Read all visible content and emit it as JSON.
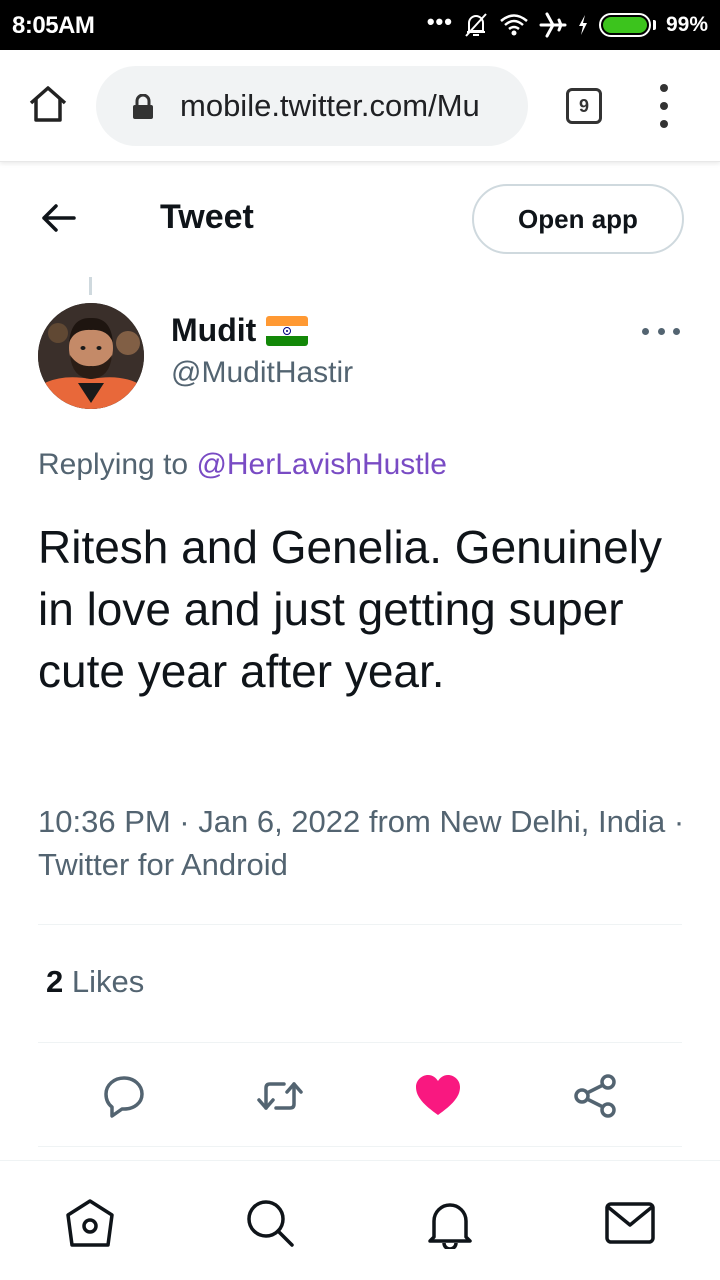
{
  "status_bar": {
    "time": "8:05AM",
    "battery_text": "99%",
    "icons": [
      "more-dots-icon",
      "notifications-off-icon",
      "wifi-icon",
      "airplane-icon",
      "charging-icon",
      "battery-icon"
    ],
    "battery_color": "#3cc41d"
  },
  "browser": {
    "url": "mobile.twitter.com/Mu",
    "tab_count": "9"
  },
  "header": {
    "title": "Tweet",
    "open_app_label": "Open app"
  },
  "tweet": {
    "author_name": "Mudit",
    "author_handle": "@MuditHastir",
    "replying_prefix": "Replying to",
    "replying_to": "@HerLavishHustle",
    "text": "Ritesh and Genelia. Genuinely in love and just getting super cute year after year.",
    "meta": "10:36 PM · Jan 6, 2022 from New Delhi, India · Twitter for Android",
    "likes_count": "2",
    "likes_label": "Likes",
    "mention_color": "#794bc4",
    "like_color": "#f91880"
  },
  "actions": [
    "reply-icon",
    "retweet-icon",
    "like-icon",
    "share-icon"
  ],
  "bottom_nav": [
    "home-icon",
    "search-icon",
    "notifications-icon",
    "messages-icon"
  ]
}
